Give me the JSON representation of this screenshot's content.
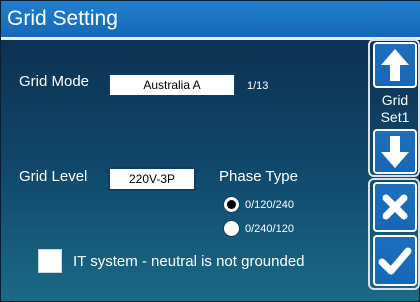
{
  "header": {
    "title": "Grid Setting"
  },
  "grid_mode": {
    "label": "Grid Mode",
    "value": "Australia A",
    "page": "1/13"
  },
  "grid_level": {
    "label": "Grid Level",
    "value": "220V-3P"
  },
  "phase_type": {
    "label": "Phase Type",
    "options": [
      {
        "label": "0/120/240",
        "selected": true
      },
      {
        "label": "0/240/120",
        "selected": false
      }
    ]
  },
  "it_system": {
    "label": "IT system - neutral is not grounded",
    "checked": false
  },
  "side_panel": {
    "caption_line1": "Grid",
    "caption_line2": "Set1"
  },
  "icons": {
    "up": "arrow-up-icon",
    "down": "arrow-down-icon",
    "cancel": "x-icon",
    "confirm": "check-icon"
  },
  "colors": {
    "accent": "#1f7fcf",
    "background_top": "#0c2a4a",
    "background_bottom": "#1a6a86"
  }
}
